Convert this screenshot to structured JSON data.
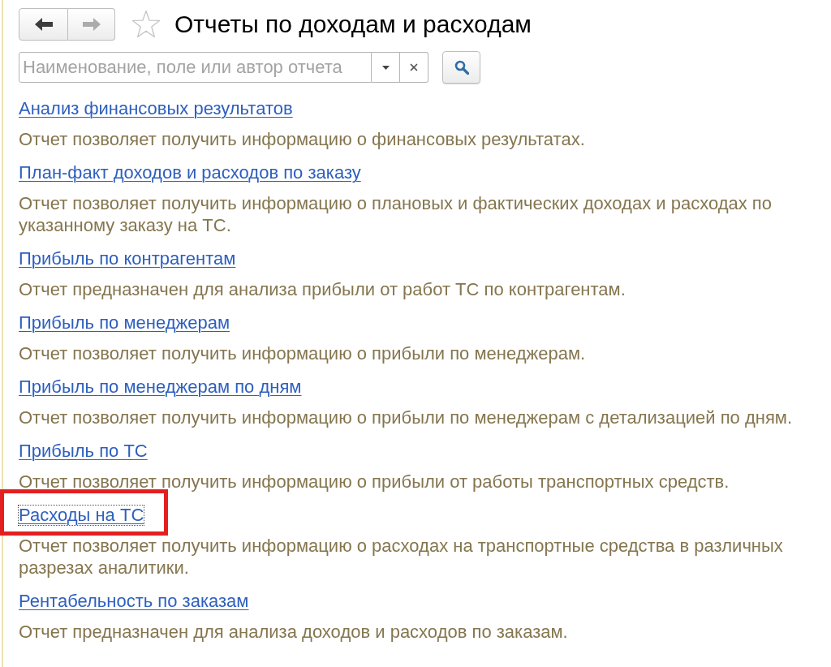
{
  "nav": {
    "back": {
      "disabled": false
    },
    "forward": {
      "disabled": true
    }
  },
  "favorite": {
    "on": false
  },
  "title": "Отчеты по доходам и расходам",
  "search": {
    "placeholder": "Наименование, поле или автор отчета"
  },
  "reports": [
    {
      "title": "Анализ финансовых результатов",
      "description": "Отчет позволяет получить информацию о финансовых результатах.",
      "focused": false,
      "highlighted": false
    },
    {
      "title": "План-факт доходов и расходов по заказу",
      "description": "Отчет позволяет получить информацию о плановых и фактических доходах и расходах по указанному заказу на ТС.",
      "focused": false,
      "highlighted": false
    },
    {
      "title": "Прибыль по контрагентам",
      "description": "Отчет предназначен для анализа прибыли от работ ТС по контрагентам.",
      "focused": false,
      "highlighted": false
    },
    {
      "title": "Прибыль по менеджерам",
      "description": "Отчет позволяет получить информацию о прибыли по менеджерам.",
      "focused": false,
      "highlighted": false
    },
    {
      "title": "Прибыль по менеджерам по дням",
      "description": "Отчет позволяет получить информацию о прибыли по менеджерам с детализацией по дням.",
      "focused": false,
      "highlighted": false
    },
    {
      "title": "Прибыль по ТС",
      "description": "Отчет позволяет получить информацию о прибыли от работы транспортных средств.",
      "focused": false,
      "highlighted": false
    },
    {
      "title": "Расходы на ТС",
      "description": "Отчет позволяет получить информацию о расходах на транспортные средства в различных разрезах аналитики.",
      "focused": true,
      "highlighted": true
    },
    {
      "title": "Рентабельность по заказам",
      "description": "Отчет предназначен для анализа доходов и расходов по заказам.",
      "focused": false,
      "highlighted": false
    }
  ]
}
